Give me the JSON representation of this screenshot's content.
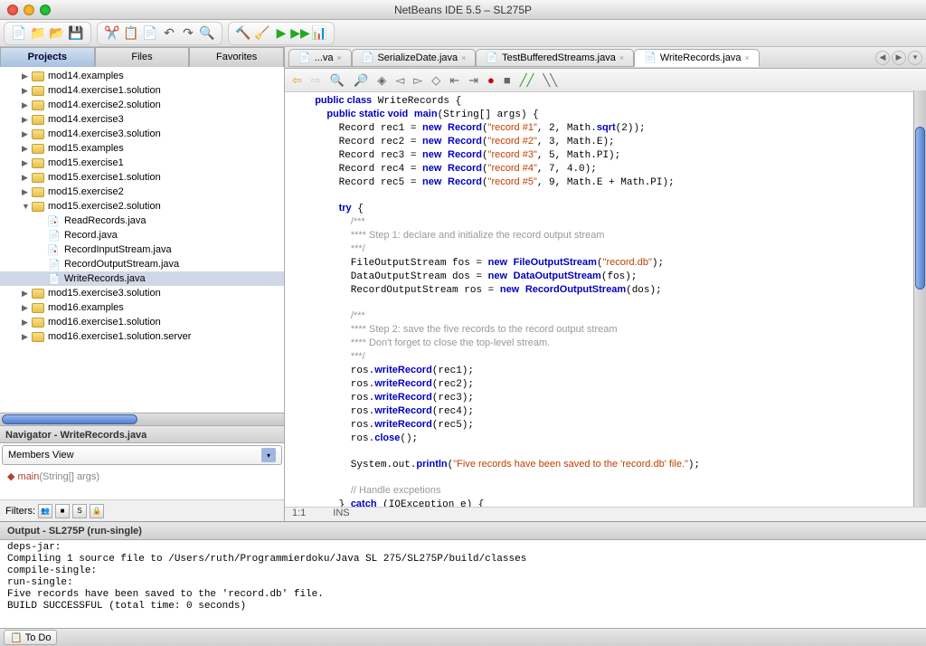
{
  "window": {
    "title": "NetBeans IDE 5.5 – SL275P"
  },
  "sidebar_tabs": {
    "projects": "Projects",
    "files": "Files",
    "favorites": "Favorites"
  },
  "tree": [
    {
      "l": "mod14.examples",
      "d": 1,
      "t": "p"
    },
    {
      "l": "mod14.exercise1.solution",
      "d": 1,
      "t": "p"
    },
    {
      "l": "mod14.exercise2.solution",
      "d": 1,
      "t": "p"
    },
    {
      "l": "mod14.exercise3",
      "d": 1,
      "t": "p"
    },
    {
      "l": "mod14.exercise3.solution",
      "d": 1,
      "t": "p"
    },
    {
      "l": "mod15.examples",
      "d": 1,
      "t": "p"
    },
    {
      "l": "mod15.exercise1",
      "d": 1,
      "t": "p"
    },
    {
      "l": "mod15.exercise1.solution",
      "d": 1,
      "t": "p"
    },
    {
      "l": "mod15.exercise2",
      "d": 1,
      "t": "p"
    },
    {
      "l": "mod15.exercise2.solution",
      "d": 1,
      "t": "p",
      "open": true
    },
    {
      "l": "ReadRecords.java",
      "d": 2,
      "t": "j",
      "err": true
    },
    {
      "l": "Record.java",
      "d": 2,
      "t": "j"
    },
    {
      "l": "RecordInputStream.java",
      "d": 2,
      "t": "j",
      "err": true
    },
    {
      "l": "RecordOutputStream.java",
      "d": 2,
      "t": "j"
    },
    {
      "l": "WriteRecords.java",
      "d": 2,
      "t": "j",
      "sel": true
    },
    {
      "l": "mod15.exercise3.solution",
      "d": 1,
      "t": "p"
    },
    {
      "l": "mod16.examples",
      "d": 1,
      "t": "p"
    },
    {
      "l": "mod16.exercise1.solution",
      "d": 1,
      "t": "p"
    },
    {
      "l": "mod16.exercise1.solution.server",
      "d": 1,
      "t": "p"
    }
  ],
  "navigator": {
    "title": "Navigator - WriteRecords.java",
    "view": "Members View",
    "member": "main",
    "member_sig": "(String[] args)",
    "filters_label": "Filters:"
  },
  "editor_tabs": [
    {
      "label": "...va"
    },
    {
      "label": "SerializeDate.java"
    },
    {
      "label": "TestBufferedStreams.java"
    },
    {
      "label": "WriteRecords.java",
      "active": true
    }
  ],
  "code_lines": [
    {
      "i": 1,
      "seg": [
        [
          "kw",
          "public class"
        ],
        [
          "",
          " WriteRecords {"
        ]
      ]
    },
    {
      "i": 2,
      "seg": [
        [
          "kw",
          "public static void"
        ],
        [
          "",
          " "
        ],
        [
          "kw",
          "main"
        ],
        [
          "",
          "(String[] args) {"
        ]
      ]
    },
    {
      "i": 3,
      "seg": [
        [
          "",
          "Record rec1 = "
        ],
        [
          "kw",
          "new"
        ],
        [
          "",
          " "
        ],
        [
          "kw",
          "Record"
        ],
        [
          "",
          "("
        ],
        [
          "str",
          "\"record #1\""
        ],
        [
          "",
          ", 2, Math."
        ],
        [
          "kw",
          "sqrt"
        ],
        [
          "",
          "(2));"
        ]
      ]
    },
    {
      "i": 3,
      "seg": [
        [
          "",
          "Record rec2 = "
        ],
        [
          "kw",
          "new"
        ],
        [
          "",
          " "
        ],
        [
          "kw",
          "Record"
        ],
        [
          "",
          "("
        ],
        [
          "str",
          "\"record #2\""
        ],
        [
          "",
          ", 3, Math.E);"
        ]
      ]
    },
    {
      "i": 3,
      "seg": [
        [
          "",
          "Record rec3 = "
        ],
        [
          "kw",
          "new"
        ],
        [
          "",
          " "
        ],
        [
          "kw",
          "Record"
        ],
        [
          "",
          "("
        ],
        [
          "str",
          "\"record #3\""
        ],
        [
          "",
          ", 5, Math.PI);"
        ]
      ]
    },
    {
      "i": 3,
      "seg": [
        [
          "",
          "Record rec4 = "
        ],
        [
          "kw",
          "new"
        ],
        [
          "",
          " "
        ],
        [
          "kw",
          "Record"
        ],
        [
          "",
          "("
        ],
        [
          "str",
          "\"record #4\""
        ],
        [
          "",
          ", 7, 4.0);"
        ]
      ]
    },
    {
      "i": 3,
      "seg": [
        [
          "",
          "Record rec5 = "
        ],
        [
          "kw",
          "new"
        ],
        [
          "",
          " "
        ],
        [
          "kw",
          "Record"
        ],
        [
          "",
          "("
        ],
        [
          "str",
          "\"record #5\""
        ],
        [
          "",
          ", 9, Math.E + Math.PI);"
        ]
      ]
    },
    {
      "i": 3,
      "seg": [
        [
          "",
          ""
        ]
      ]
    },
    {
      "i": 3,
      "seg": [
        [
          "kw",
          "try"
        ],
        [
          "",
          " {"
        ]
      ]
    },
    {
      "i": 4,
      "seg": [
        [
          "cm",
          "/***"
        ]
      ]
    },
    {
      "i": 4,
      "seg": [
        [
          "cm",
          "**** Step 1: declare and initialize the record output stream"
        ]
      ]
    },
    {
      "i": 4,
      "seg": [
        [
          "cm",
          "***/"
        ]
      ]
    },
    {
      "i": 4,
      "seg": [
        [
          "",
          "FileOutputStream fos = "
        ],
        [
          "kw",
          "new"
        ],
        [
          "",
          " "
        ],
        [
          "kw",
          "FileOutputStream"
        ],
        [
          "",
          "("
        ],
        [
          "str",
          "\"record.db\""
        ],
        [
          "",
          ");"
        ]
      ]
    },
    {
      "i": 4,
      "seg": [
        [
          "",
          "DataOutputStream dos = "
        ],
        [
          "kw",
          "new"
        ],
        [
          "",
          " "
        ],
        [
          "kw",
          "DataOutputStream"
        ],
        [
          "",
          "(fos);"
        ]
      ]
    },
    {
      "i": 4,
      "seg": [
        [
          "",
          "RecordOutputStream ros = "
        ],
        [
          "kw",
          "new"
        ],
        [
          "",
          " "
        ],
        [
          "kw",
          "RecordOutputStream"
        ],
        [
          "",
          "(dos);"
        ]
      ]
    },
    {
      "i": 4,
      "seg": [
        [
          "",
          ""
        ]
      ]
    },
    {
      "i": 4,
      "seg": [
        [
          "cm",
          "/***"
        ]
      ]
    },
    {
      "i": 4,
      "seg": [
        [
          "cm",
          "**** Step 2: save the five records to the record output stream"
        ]
      ]
    },
    {
      "i": 4,
      "seg": [
        [
          "cm",
          "**** Don't forget to close the top-level stream."
        ]
      ]
    },
    {
      "i": 4,
      "seg": [
        [
          "cm",
          "***/"
        ]
      ]
    },
    {
      "i": 4,
      "seg": [
        [
          "",
          "ros."
        ],
        [
          "kw",
          "writeRecord"
        ],
        [
          "",
          "(rec1);"
        ]
      ]
    },
    {
      "i": 4,
      "seg": [
        [
          "",
          "ros."
        ],
        [
          "kw",
          "writeRecord"
        ],
        [
          "",
          "(rec2);"
        ]
      ]
    },
    {
      "i": 4,
      "seg": [
        [
          "",
          "ros."
        ],
        [
          "kw",
          "writeRecord"
        ],
        [
          "",
          "(rec3);"
        ]
      ]
    },
    {
      "i": 4,
      "seg": [
        [
          "",
          "ros."
        ],
        [
          "kw",
          "writeRecord"
        ],
        [
          "",
          "(rec4);"
        ]
      ]
    },
    {
      "i": 4,
      "seg": [
        [
          "",
          "ros."
        ],
        [
          "kw",
          "writeRecord"
        ],
        [
          "",
          "(rec5);"
        ]
      ]
    },
    {
      "i": 4,
      "seg": [
        [
          "",
          "ros."
        ],
        [
          "kw",
          "close"
        ],
        [
          "",
          "();"
        ]
      ]
    },
    {
      "i": 4,
      "seg": [
        [
          "",
          ""
        ]
      ]
    },
    {
      "i": 4,
      "seg": [
        [
          "",
          "System.out."
        ],
        [
          "kw",
          "println"
        ],
        [
          "",
          "("
        ],
        [
          "str",
          "\"Five records have been saved to the 'record.db' file.\""
        ],
        [
          "",
          ");"
        ]
      ]
    },
    {
      "i": 4,
      "seg": [
        [
          "",
          ""
        ]
      ]
    },
    {
      "i": 4,
      "seg": [
        [
          "cm",
          "// Handle excpetions"
        ]
      ]
    },
    {
      "i": 3,
      "seg": [
        [
          "",
          "} "
        ],
        [
          "kw",
          "catch"
        ],
        [
          "",
          " (IOException e) {"
        ]
      ]
    }
  ],
  "status": {
    "pos": "1:1",
    "mode": "INS"
  },
  "output": {
    "title": "Output - SL275P (run-single)",
    "lines": [
      "deps-jar:",
      "Compiling 1 source file to /Users/ruth/Programmierdoku/Java SL 275/SL275P/build/classes",
      "compile-single:",
      "run-single:",
      "Five records have been saved to the 'record.db' file.",
      "BUILD SUCCESSFUL (total time: 0 seconds)"
    ]
  },
  "bottom": {
    "todo": "To Do"
  }
}
